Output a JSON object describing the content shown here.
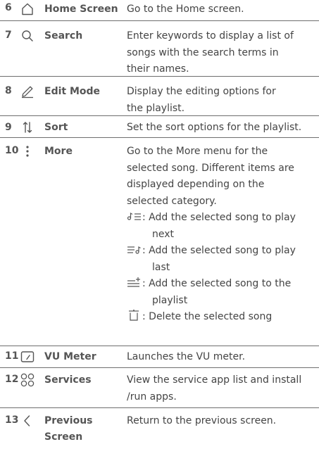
{
  "rows": [
    {
      "num": "6",
      "icon": "home-icon",
      "name": "Home Screen",
      "desc": "Go to the Home screen."
    },
    {
      "num": "7",
      "icon": "search-icon",
      "name": "Search",
      "desc": [
        "Enter keywords to display a list of",
        "songs with the search terms in",
        "their names."
      ]
    },
    {
      "num": "8",
      "icon": "pencil-icon",
      "name": "Edit Mode",
      "desc": [
        "Display the editing options for",
        "the playlist."
      ]
    },
    {
      "num": "9",
      "icon": "sort-icon",
      "name": "Sort",
      "desc": "Set the sort options for the playlist."
    },
    {
      "num": "10",
      "icon": "more-vertical-icon",
      "name": "More",
      "desc": [
        "Go to the More menu for the",
        "selected song. Different items are",
        "displayed depending on the",
        "selected category."
      ],
      "subitems": [
        {
          "icon": "play-next-icon",
          "line1": ": Add the selected song to play",
          "line2": "next"
        },
        {
          "icon": "play-last-icon",
          "line1": ": Add the selected song to play",
          "line2": "last"
        },
        {
          "icon": "add-to-playlist-icon",
          "line1": ": Add the selected song to the",
          "line2": "playlist"
        },
        {
          "icon": "delete-icon",
          "line1": ": Delete the selected song"
        }
      ]
    },
    {
      "num": "11",
      "icon": "vu-meter-icon",
      "name": "VU Meter",
      "desc": "Launches the VU meter."
    },
    {
      "num": "12",
      "icon": "services-icon",
      "name": "Services",
      "desc": [
        "View the service app list and install",
        "/run apps."
      ]
    },
    {
      "num": "13",
      "icon": "back-icon",
      "name": [
        "Previous",
        "Screen"
      ],
      "desc": "Return to the previous screen."
    }
  ]
}
